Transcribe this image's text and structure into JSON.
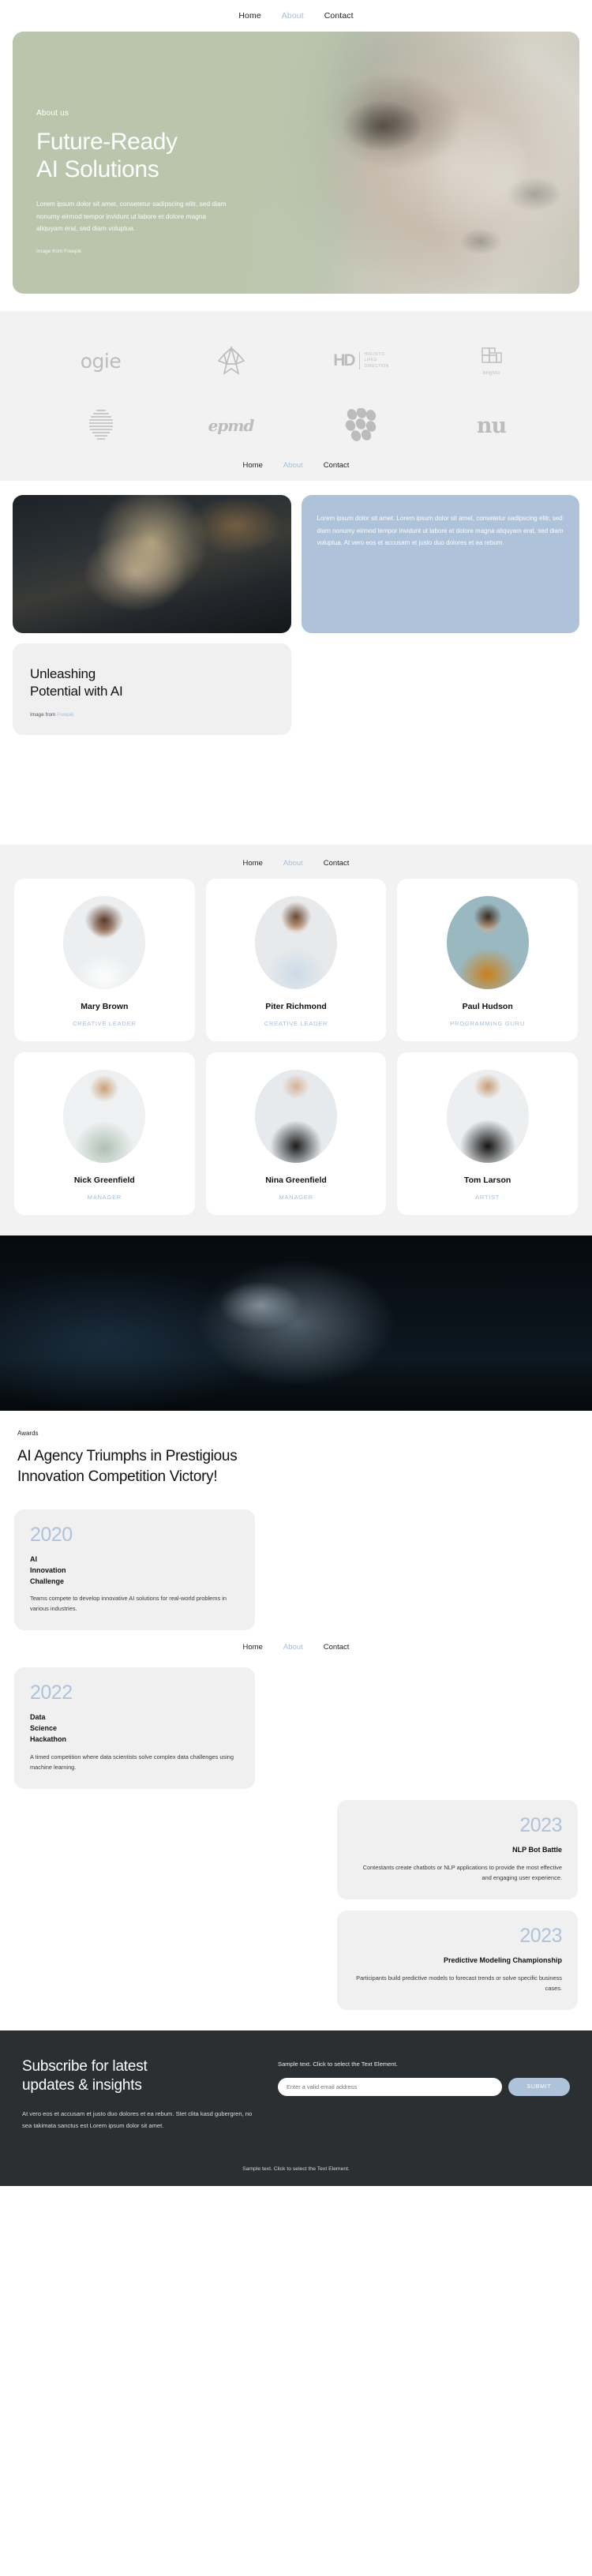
{
  "nav": {
    "items": [
      {
        "label": "Home",
        "muted": false
      },
      {
        "label": "About",
        "muted": true
      },
      {
        "label": "Contact",
        "muted": false
      }
    ]
  },
  "hero": {
    "eyebrow": "About us",
    "title_line1": "Future-Ready",
    "title_line2": "AI Solutions",
    "paragraph": "Lorem ipsum dolor sit amet, consetetur sadipscing elitr, sed diam nonumy eirmod tempor invidunt ut labore et dolore magna aliquyam erat, sed diam voluptua.",
    "credit": "Image from Freepik",
    "bg_color": "#b9c6ac"
  },
  "logos": {
    "items": [
      {
        "name": "ogie",
        "text": "ogie"
      },
      {
        "name": "flower-mark",
        "text": ""
      },
      {
        "name": "holistic-lifes-direction",
        "text": "HD",
        "sub1": "HOLISTIC",
        "sub2": "LIFES",
        "sub3": "DIRECTION"
      },
      {
        "name": "brighto",
        "text": "brighto"
      },
      {
        "name": "striped-sphere",
        "text": ""
      },
      {
        "name": "epmd",
        "text": "epmd"
      },
      {
        "name": "dots-cluster",
        "text": ""
      },
      {
        "name": "nu-monogram",
        "text": "nu"
      }
    ]
  },
  "showcase": {
    "blue_card_text": "Lorem ipsum dolor sit amet. Lorem ipsum dolor sit amet, consetetur sadipscing elitr, sed diam nonumy eirmod tempor invidunt ut labore et dolore magna aliquyam erat, sed diam voluptua. At vero eos et accusam et justo duo dolores et ea rebum.",
    "card_title_line1": "Unleashing",
    "card_title_line2": "Potential with AI",
    "card_credit_prefix": "Image from ",
    "card_credit_link": "Freepik"
  },
  "team": {
    "members": [
      {
        "name": "Mary Brown",
        "role": "CREATIVE LEADER"
      },
      {
        "name": "Piter Richmond",
        "role": "CREATIVE LEADER"
      },
      {
        "name": "Paul Hudson",
        "role": "PROGRAMMING GURU"
      },
      {
        "name": "Nick Greenfield",
        "role": "MANAGER"
      },
      {
        "name": "Nina Greenfield",
        "role": "MANAGER"
      },
      {
        "name": "Tom Larson",
        "role": "ARTIST"
      }
    ]
  },
  "awards": {
    "label": "Awards",
    "heading_line1": "AI Agency Triumphs in Prestigious",
    "heading_line2": "Innovation Competition Victory!",
    "timeline": [
      {
        "year": "2020",
        "title": "AI\nInnovation\nChallenge",
        "desc": "Teams compete to develop innovative AI solutions for real-world problems in various industries.",
        "align": "left"
      },
      {
        "year": "2022",
        "title": "Data\nScience\nHackathon",
        "desc": "A timed competition where data scientists solve complex data challenges using machine learning.",
        "align": "left"
      },
      {
        "year": "2023",
        "title": "NLP Bot Battle",
        "desc": "Contestants create chatbots or NLP applications to provide the most effective and engaging user experience.",
        "align": "right"
      },
      {
        "year": "2023",
        "title": "Predictive Modeling Championship",
        "desc": "Participants build predictive models to forecast trends or solve specific business cases.",
        "align": "right"
      }
    ],
    "year_color": "#aec3d9"
  },
  "footer": {
    "heading_line1": "Subscribe for latest",
    "heading_line2": "updates & insights",
    "paragraph": "At vero eos et accusam et justo duo dolores et ea rebum. Stet clita kasd gubergren, no sea takimata sanctus est Lorem ipsum dolor sit amet.",
    "sample_text": "Sample text. Click to select the Text Element.",
    "email_placeholder": "Enter a valid email address",
    "submit_label": "SUBMIT",
    "bottom_text": "Sample text. Click to select the Text Element.",
    "bg_color": "#2b2f31",
    "accent_color": "#aec3d9"
  }
}
